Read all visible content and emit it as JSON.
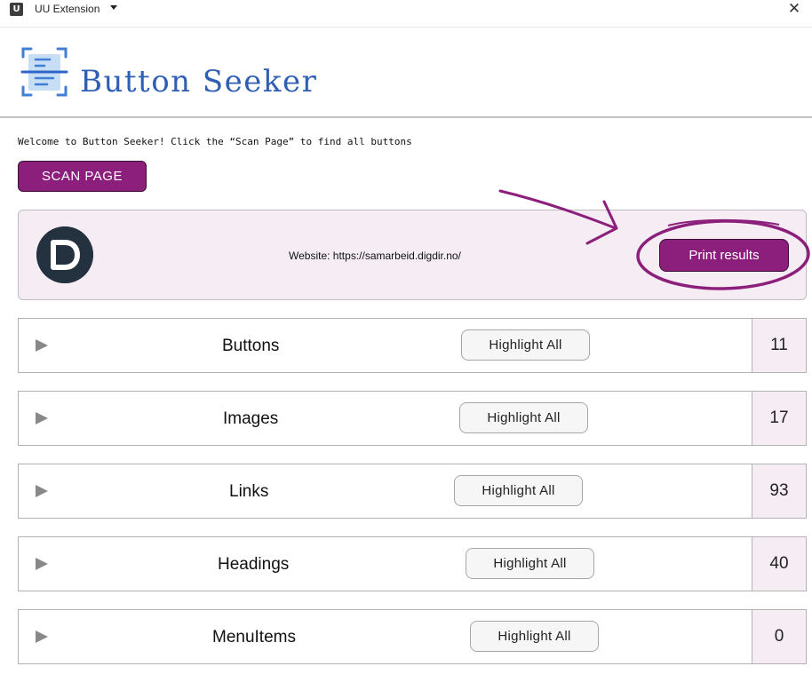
{
  "window": {
    "app_icon_letter": "U",
    "title": "UU Extension",
    "close_glyph": "✕"
  },
  "header": {
    "title": "Button Seeker",
    "logo_icon": "document-scan-icon"
  },
  "intro": {
    "welcome_text": "Welcome to Button Seeker! Click the “Scan Page” to find all buttons",
    "scan_button_label": "SCAN PAGE"
  },
  "site": {
    "website_text": "Website: https://samarbeid.digdir.no/",
    "logo_letter": "D",
    "print_button_label": "Print results"
  },
  "categories": [
    {
      "name": "Buttons",
      "highlight_label": "Highlight All",
      "count": "11"
    },
    {
      "name": "Images",
      "highlight_label": "Highlight All",
      "count": "17"
    },
    {
      "name": "Links",
      "highlight_label": "Highlight All",
      "count": "93"
    },
    {
      "name": "Headings",
      "highlight_label": "Highlight All",
      "count": "40"
    },
    {
      "name": "MenuItems",
      "highlight_label": "Highlight All",
      "count": "0"
    }
  ],
  "colors": {
    "accent": "#8b1f7b",
    "title_blue": "#2f5fb3",
    "panel_tint": "#f5ecf4",
    "annotation": "#8b1f7b"
  }
}
